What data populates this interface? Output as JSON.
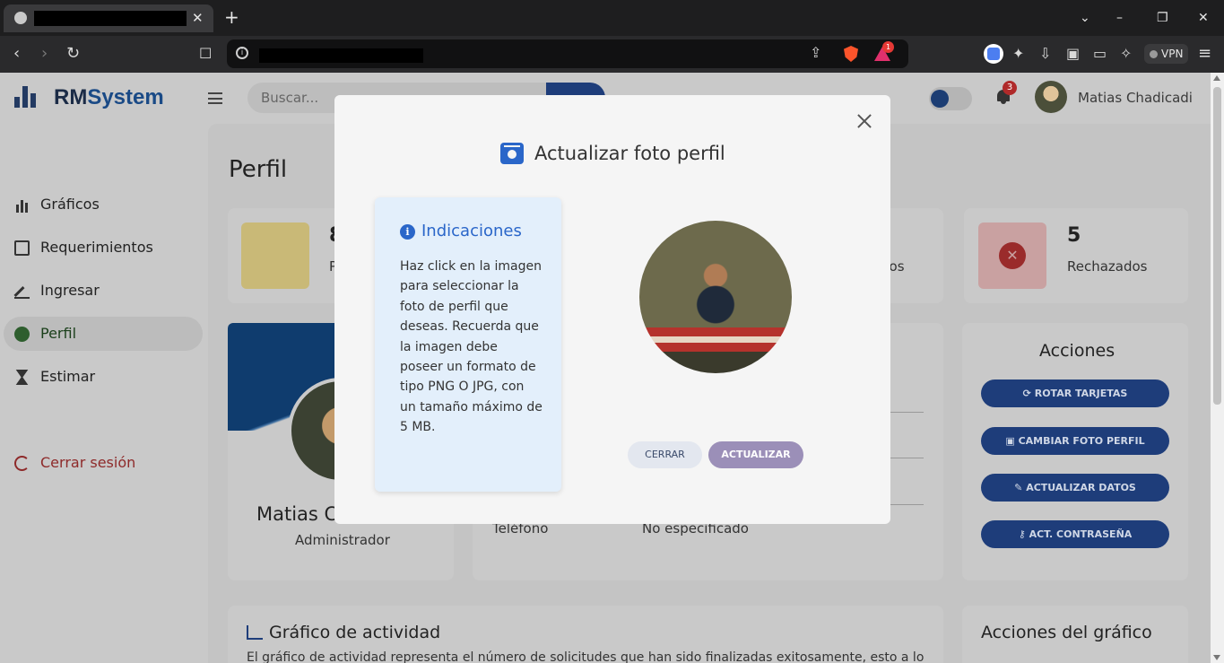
{
  "browser": {
    "tab_close": "✕",
    "new_tab": "+",
    "vpn_label": "VPN",
    "rewards_badge": "1",
    "window_controls": {
      "dropdown": "⌄",
      "minimize": "–",
      "restore": "❐",
      "close": "✕"
    },
    "nav": {
      "back": "‹",
      "forward": "›",
      "reload": "↻",
      "bookmark": "☐",
      "share": "⇪",
      "menu": "≡"
    },
    "info_icon": "i"
  },
  "app": {
    "brand_part1": "RM",
    "brand_part2": "System",
    "search_placeholder": "Buscar...",
    "notifications_count": "3",
    "user_name": "Matias Chadicadi"
  },
  "sidebar": {
    "items": [
      {
        "label": "Gráficos",
        "icon": "bar-chart-icon"
      },
      {
        "label": "Requerimientos",
        "icon": "clipboard-icon"
      },
      {
        "label": "Ingresar",
        "icon": "pen-icon"
      },
      {
        "label": "Perfil",
        "icon": "user-circle-icon",
        "active": true
      },
      {
        "label": "Estimar",
        "icon": "hourglass-icon"
      }
    ],
    "logout_label": "Cerrar sesión"
  },
  "page": {
    "title": "Perfil",
    "stats": [
      {
        "value": "8",
        "label": "P",
        "color": "#e8c84a"
      },
      {
        "value": "",
        "label": "dos",
        "color": "#2a66c9"
      },
      {
        "value": "5",
        "label": "Rechazados",
        "color": "#d93636"
      }
    ],
    "profile_name": "Matias C",
    "profile_role": "Administrador",
    "details": {
      "phone_label": "Teléfono",
      "phone_value": "No especificado"
    },
    "actions_title": "Acciones",
    "actions": [
      {
        "label": "ROTAR TARJETAS",
        "icon": "refresh-icon"
      },
      {
        "label": "CAMBIAR FOTO PERFIL",
        "icon": "camera-icon"
      },
      {
        "label": "ACTUALIZAR DATOS",
        "icon": "user-edit-icon"
      },
      {
        "label": "ACT. CONTRASEÑA",
        "icon": "key-icon"
      }
    ],
    "chart_title": "Gráfico de actividad",
    "chart_desc": "El gráfico de actividad representa el número de solicitudes que han sido finalizadas exitosamente, esto a lo",
    "chart_actions_title": "Acciones del gráfico"
  },
  "modal": {
    "title": "Actualizar foto perfil",
    "info_title": "Indicaciones",
    "info_text": "Haz click en la imagen para seleccionar la foto de perfil que deseas. Recuerda que la imagen debe poseer un formato de tipo PNG O JPG, con un tamaño máximo de 5 MB.",
    "cancel_label": "CERRAR",
    "submit_label": "ACTUALIZAR",
    "accent_color": "#2a66c9"
  }
}
